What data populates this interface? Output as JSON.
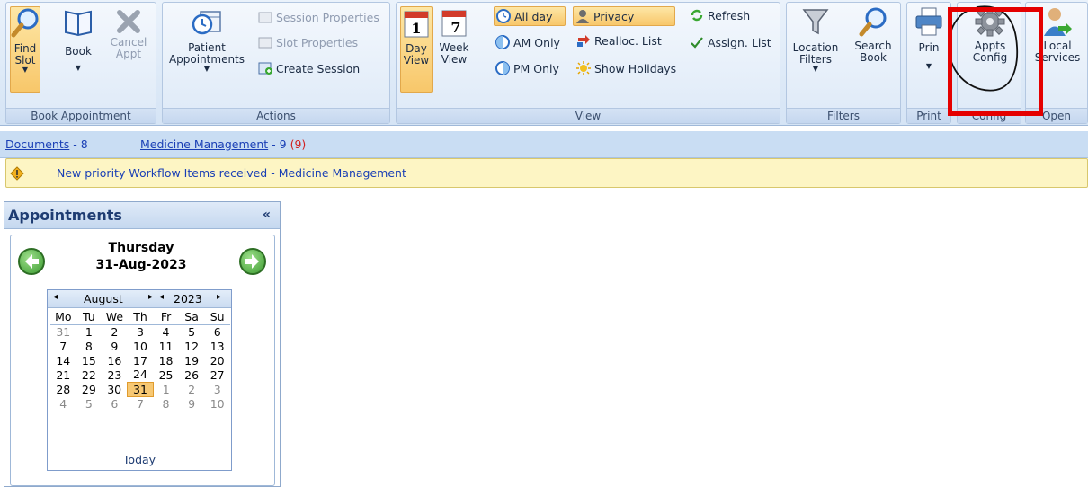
{
  "ribbon": {
    "book_appointment": {
      "title": "Book Appointment",
      "find_slot": "Find\nSlot",
      "book": "Book",
      "cancel_appt": "Cancel\nAppt"
    },
    "actions": {
      "title": "Actions",
      "patient_appointments": "Patient\nAppointments",
      "session_properties": "Session Properties",
      "slot_properties": "Slot Properties",
      "create_session": "Create Session"
    },
    "view": {
      "title": "View",
      "day_view": "Day\nView",
      "day_icon_num": "1",
      "week_view": "Week\nView",
      "week_icon_num": "7",
      "all_day": "All day",
      "am_only": "AM Only",
      "pm_only": "PM Only",
      "privacy": "Privacy",
      "realloc_list": "Realloc. List",
      "show_holidays": "Show Holidays",
      "refresh": "Refresh",
      "assign_list": "Assign. List"
    },
    "filters": {
      "title": "Filters",
      "location_filters": "Location\nFilters",
      "search_book": "Search\nBook"
    },
    "print": {
      "title": "Print",
      "print": "Prin"
    },
    "config": {
      "title": "Config",
      "appts_config": "Appts\nConfig"
    },
    "open": {
      "title": "Open",
      "local_services": "Local\nServices"
    }
  },
  "messages": {
    "documents_label": "Documents",
    "documents_count": " - 8",
    "medicine_label": "Medicine Management",
    "medicine_count": " - 9 ",
    "medicine_priority": "(9)",
    "notice": "New priority Workflow Items received - Medicine Management"
  },
  "appointments": {
    "title": "Appointments",
    "collapse": "«",
    "day_name": "Thursday",
    "date": "31-Aug-2023",
    "month": "August",
    "year": "2023",
    "weekdays": [
      "Mo",
      "Tu",
      "We",
      "Th",
      "Fr",
      "Sa",
      "Su"
    ],
    "weeks": [
      [
        "31",
        "1",
        "2",
        "3",
        "4",
        "5",
        "6"
      ],
      [
        "7",
        "8",
        "9",
        "10",
        "11",
        "12",
        "13"
      ],
      [
        "14",
        "15",
        "16",
        "17",
        "18",
        "19",
        "20"
      ],
      [
        "21",
        "22",
        "23",
        "24",
        "25",
        "26",
        "27"
      ],
      [
        "28",
        "29",
        "30",
        "31",
        "1",
        "2",
        "3"
      ],
      [
        "4",
        "5",
        "6",
        "7",
        "8",
        "9",
        "10"
      ]
    ],
    "today_label": "Today"
  },
  "colors": {
    "accent": "#f7c873",
    "highlight": "#e50000",
    "link": "#1a3fb5"
  }
}
